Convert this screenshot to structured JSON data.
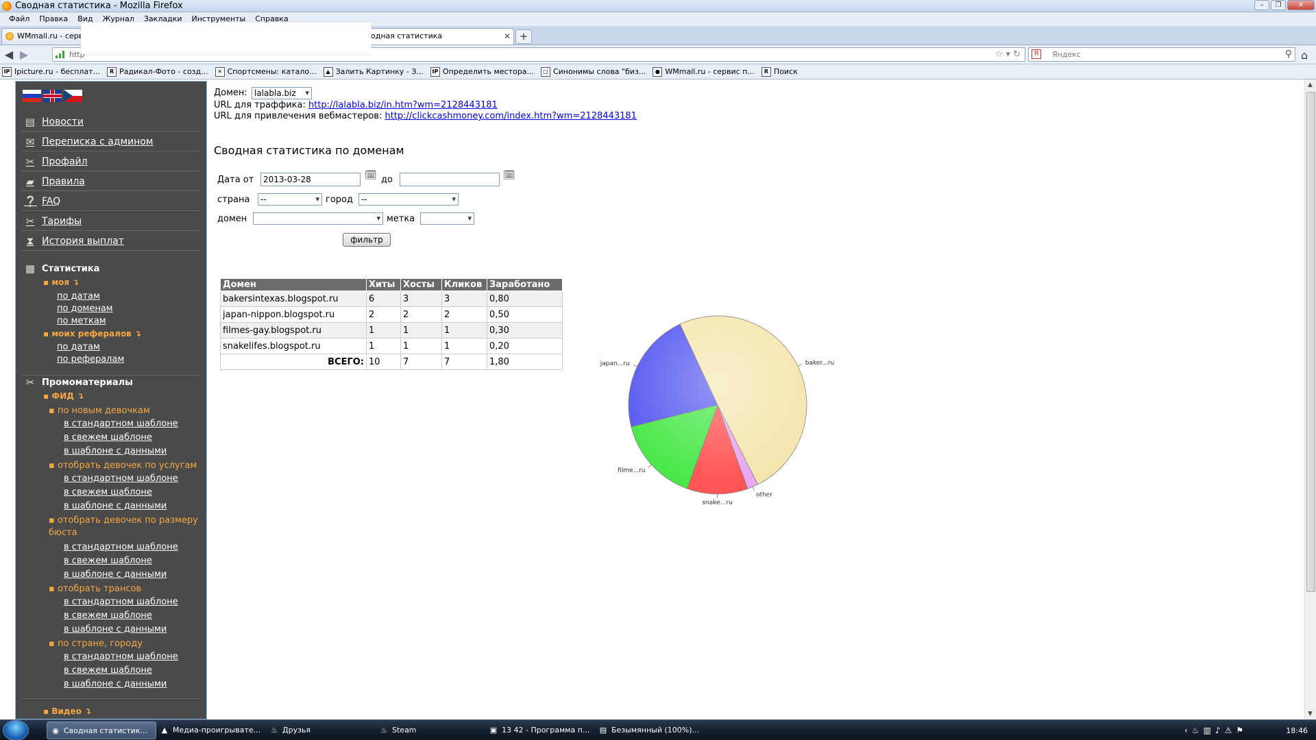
{
  "window": {
    "title": "Сводная статистика - Mozilla Firefox"
  },
  "menu": [
    "Файл",
    "Правка",
    "Вид",
    "Журнал",
    "Закладки",
    "Инструменты",
    "Справка"
  ],
  "tabs": [
    {
      "label": "WMmail.ru - сервис"
    },
    {
      "label": "одная статистика"
    }
  ],
  "urlbar": {
    "value": "http"
  },
  "search": {
    "placeholder": "Яндекс"
  },
  "bookmarks": [
    {
      "icon": "IP",
      "label": "Ipicture.ru - бесплат..."
    },
    {
      "icon": "R",
      "label": "Радикал-Фото - созд..."
    },
    {
      "icon": "✕",
      "label": "Спортсмены: катало..."
    },
    {
      "icon": "▲",
      "label": "Залить Картинку - З..."
    },
    {
      "icon": "IP",
      "label": "Определить местора..."
    },
    {
      "icon": "□",
      "label": "Синонимы слова \"биз..."
    },
    {
      "icon": "●",
      "label": "WMmail.ru - сервис п..."
    },
    {
      "icon": "R",
      "label": "Поиск"
    }
  ],
  "sidebar": {
    "items": [
      {
        "label": "Новости",
        "icon": "news-icon"
      },
      {
        "label": "Переписка с админом",
        "icon": "mail-icon"
      },
      {
        "label": "Профайл",
        "icon": "tools-icon"
      },
      {
        "label": "Правила",
        "icon": "book-icon"
      },
      {
        "label": "FAQ",
        "icon": "faq-icon"
      },
      {
        "label": "Тарифы",
        "icon": "tools-icon"
      },
      {
        "label": "История выплат",
        "icon": "hourglass-icon"
      }
    ],
    "stats": {
      "title": "Статистика",
      "mine": "моя ↴",
      "mine_links": [
        "по датам",
        "по доменам",
        "по меткам"
      ],
      "refs": "моих рефералов ↴",
      "refs_links": [
        "по датам",
        "по рефералам"
      ]
    },
    "promo": {
      "title": "Промоматериалы",
      "fid": "ФИД ↴",
      "groups": [
        {
          "label": "по новым девочкам",
          "links": [
            "в стандартном шаблоне",
            "в свежем шаблоне",
            "в шаблоне с данными"
          ]
        },
        {
          "label": "отобрать девочек по услугам",
          "links": [
            "в стандартном шаблоне",
            "в свежем шаблоне",
            "в шаблоне с данными"
          ]
        },
        {
          "label": "отобрать девочек по размеру бюста",
          "links": [
            "в стандартном шаблоне",
            "в свежем шаблоне",
            "в шаблоне с данными"
          ]
        },
        {
          "label": "отобрать трансов",
          "links": [
            "в стандартном шаблоне",
            "в свежем шаблоне",
            "в шаблоне с данными"
          ]
        },
        {
          "label": "по стране, городу",
          "links": [
            "в стандартном шаблоне",
            "в свежем шаблоне",
            "в шаблоне с данными"
          ]
        }
      ],
      "video": "Видео ↴"
    }
  },
  "main": {
    "domain_label": "Домен:",
    "domain_value": "lalabla.biz",
    "traffic_label": "URL для траффика:",
    "traffic_url": "http://lalabla.biz/in.htm?wm=2128443181",
    "webmaster_label": "URL для привлечения вебмастеров:",
    "webmaster_url": "http://clickcashmoney.com/index.htm?wm=2128443181",
    "heading": "Сводная статистика по доменам",
    "filter": {
      "date_from_label": "Дата от",
      "date_from": "2013-03-28",
      "date_to_label": "до",
      "date_to": "",
      "country_label": "страна",
      "country": "--",
      "city_label": "город",
      "city": "--",
      "domain_label": "домен",
      "domain": "",
      "tag_label": "метка",
      "tag": "",
      "button": "фильтр"
    },
    "table": {
      "headers": [
        "Домен",
        "Хиты",
        "Хосты",
        "Кликов",
        "Заработано"
      ],
      "rows": [
        [
          "bakersintexas.blogspot.ru",
          "6",
          "3",
          "3",
          "0,80"
        ],
        [
          "japan-nippon.blogspot.ru",
          "2",
          "2",
          "2",
          "0,50"
        ],
        [
          "filmes-gay.blogspot.ru",
          "1",
          "1",
          "1",
          "0,30"
        ],
        [
          "snakelifes.blogspot.ru",
          "1",
          "1",
          "1",
          "0,20"
        ]
      ],
      "total_label": "ВСЕГО:",
      "total": [
        "10",
        "7",
        "7",
        "1,80"
      ]
    }
  },
  "chart_data": {
    "type": "pie",
    "labels": [
      "baker...ru",
      "other",
      "snake...ru",
      "filme...ru",
      "japan...ru"
    ],
    "values": [
      49.5,
      2,
      11,
      15.5,
      22
    ],
    "colors": [
      "#f5e6b0",
      "#e8a8f0",
      "#ff5555",
      "#4be84b",
      "#5a5cf0"
    ]
  },
  "taskbar": {
    "items": [
      {
        "label": "Сводная статистик...",
        "icon": "firefox-icon"
      },
      {
        "label": "Медиа-проигрывате...",
        "icon": "media-icon"
      },
      {
        "label": "Друзья",
        "icon": "steam-icon"
      },
      {
        "label": "Steam",
        "icon": "steam-icon"
      },
      {
        "label": "13 42 - Программа п...",
        "icon": "image-icon"
      },
      {
        "label": "Безымянный (100%)...",
        "icon": "doc-icon"
      }
    ],
    "clock": "18:46"
  }
}
